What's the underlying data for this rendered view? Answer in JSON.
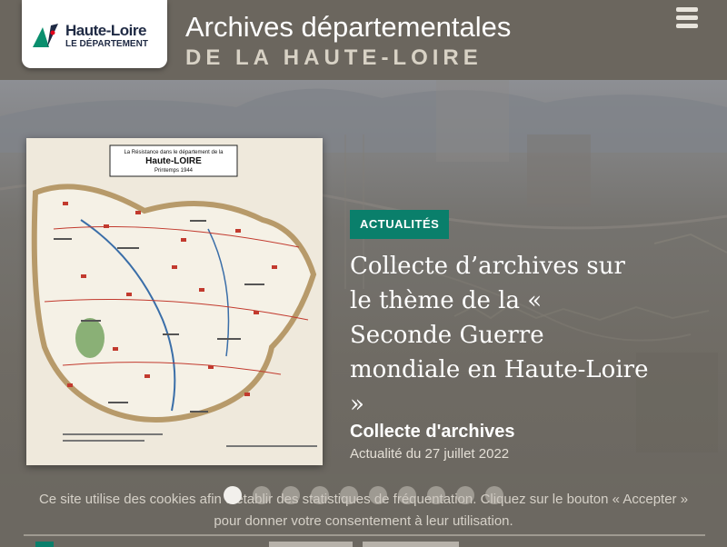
{
  "header": {
    "logo_name": "Haute-Loire",
    "logo_sub": "LE DÉPARTEMENT",
    "title": "Archives départementales",
    "subtitle": "DE LA HAUTE-LOIRE"
  },
  "hero": {
    "badge": "ACTUALITÉS",
    "article_title": "Collecte d’archives sur le thème de la « Seconde Guerre mondiale en Haute-Loire »",
    "article_subtitle": "Collecte d'archives",
    "article_meta": "Actualité du 27 juillet 2022",
    "map": {
      "title_line1": "La Résistance dans le département de la",
      "title_line2": "Haute-LOIRE",
      "title_line3": "Printemps 1944"
    },
    "slide_count": 10,
    "active_slide": 1
  },
  "cookie": {
    "text": "Ce site utilise des cookies afin d'établir des statistiques de fréquentation. Cliquez sur le bouton « Accepter » pour donner votre consentement à leur utilisation."
  },
  "colors": {
    "accent": "#0a7f6b",
    "header_bg": "#6b665e",
    "logo_navy": "#1f2a44"
  },
  "icons": {
    "menu": "hamburger-icon",
    "logo": "department-logo-icon"
  }
}
